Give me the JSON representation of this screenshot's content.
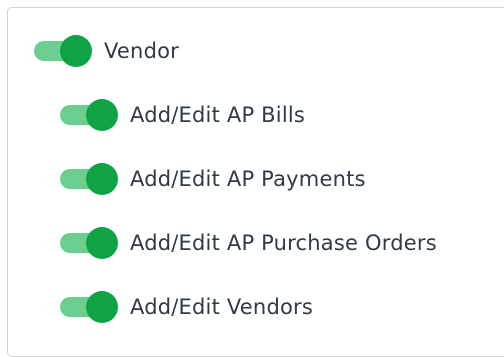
{
  "colors": {
    "toggle_track_on": "#6ccf91",
    "toggle_knob_on": "#0fa345",
    "text": "#2f3b45",
    "border": "#cfd3d6"
  },
  "permissions": {
    "parent": {
      "label": "Vendor",
      "enabled": true
    },
    "children": [
      {
        "label": "Add/Edit AP Bills",
        "enabled": true
      },
      {
        "label": "Add/Edit AP Payments",
        "enabled": true
      },
      {
        "label": "Add/Edit AP Purchase Orders",
        "enabled": true
      },
      {
        "label": "Add/Edit Vendors",
        "enabled": true
      }
    ]
  }
}
